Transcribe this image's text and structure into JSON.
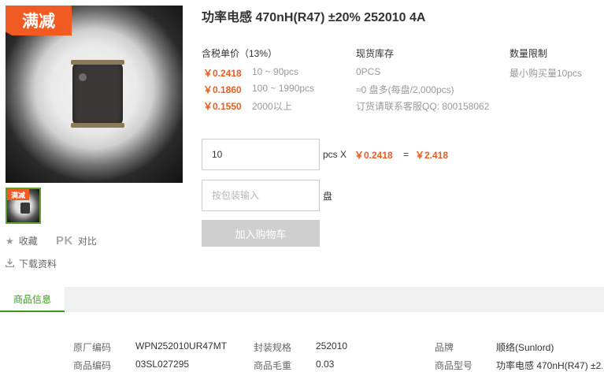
{
  "promo_badge": "满减",
  "product": {
    "title": "功率电感 470nH(R47) ±20% 252010 4A"
  },
  "sidebar": {
    "favorite_label": "收藏",
    "pk_mark": "PK",
    "compare_label": "对比",
    "download_label": "下载资料"
  },
  "pricing": {
    "header": "含税单价（13%）",
    "tiers": [
      {
        "price": "￥0.2418",
        "range": "10 ~ 90pcs"
      },
      {
        "price": "￥0.1860",
        "range": "100 ~ 1990pcs"
      },
      {
        "price": "￥0.1550",
        "range": "2000以上"
      }
    ]
  },
  "stock": {
    "header": "现货库存",
    "qty": "0PCS",
    "reel_note": "≈0 盘多(每盘/2,000pcs)",
    "contact": "订货请联系客服QQ: 800158062"
  },
  "limit": {
    "header": "数量限制",
    "min_buy": "最小购买量10pcs"
  },
  "order": {
    "qty_value": "10",
    "qty_unit": "pcs X",
    "unit_price": "￥0.2418",
    "equals": "=",
    "total": "￥2.418",
    "reel_placeholder": "按包装输入",
    "reel_unit": "盘",
    "add_cart_label": "加入购物车"
  },
  "tabs": {
    "info_label": "商品信息"
  },
  "specs": {
    "row1": [
      {
        "label": "原厂编码",
        "value": "WPN252010UR47MT"
      },
      {
        "label": "封装规格",
        "value": "252010"
      },
      {
        "label": "品牌",
        "value": "顺络(Sunlord)"
      }
    ],
    "row2": [
      {
        "label": "商品编码",
        "value": "03SL027295"
      },
      {
        "label": "商品毛重",
        "value": "0.03"
      },
      {
        "label": "商品型号",
        "value": "功率电感 470nH(R47) ±2."
      }
    ]
  },
  "colors": {
    "price_orange": "#e85b21",
    "badge_orange": "#f15a22",
    "tab_green": "#3a9a1e",
    "button_disabled": "#cfcfcf"
  },
  "icons": {
    "favorite": "star-icon",
    "download": "download-icon"
  }
}
